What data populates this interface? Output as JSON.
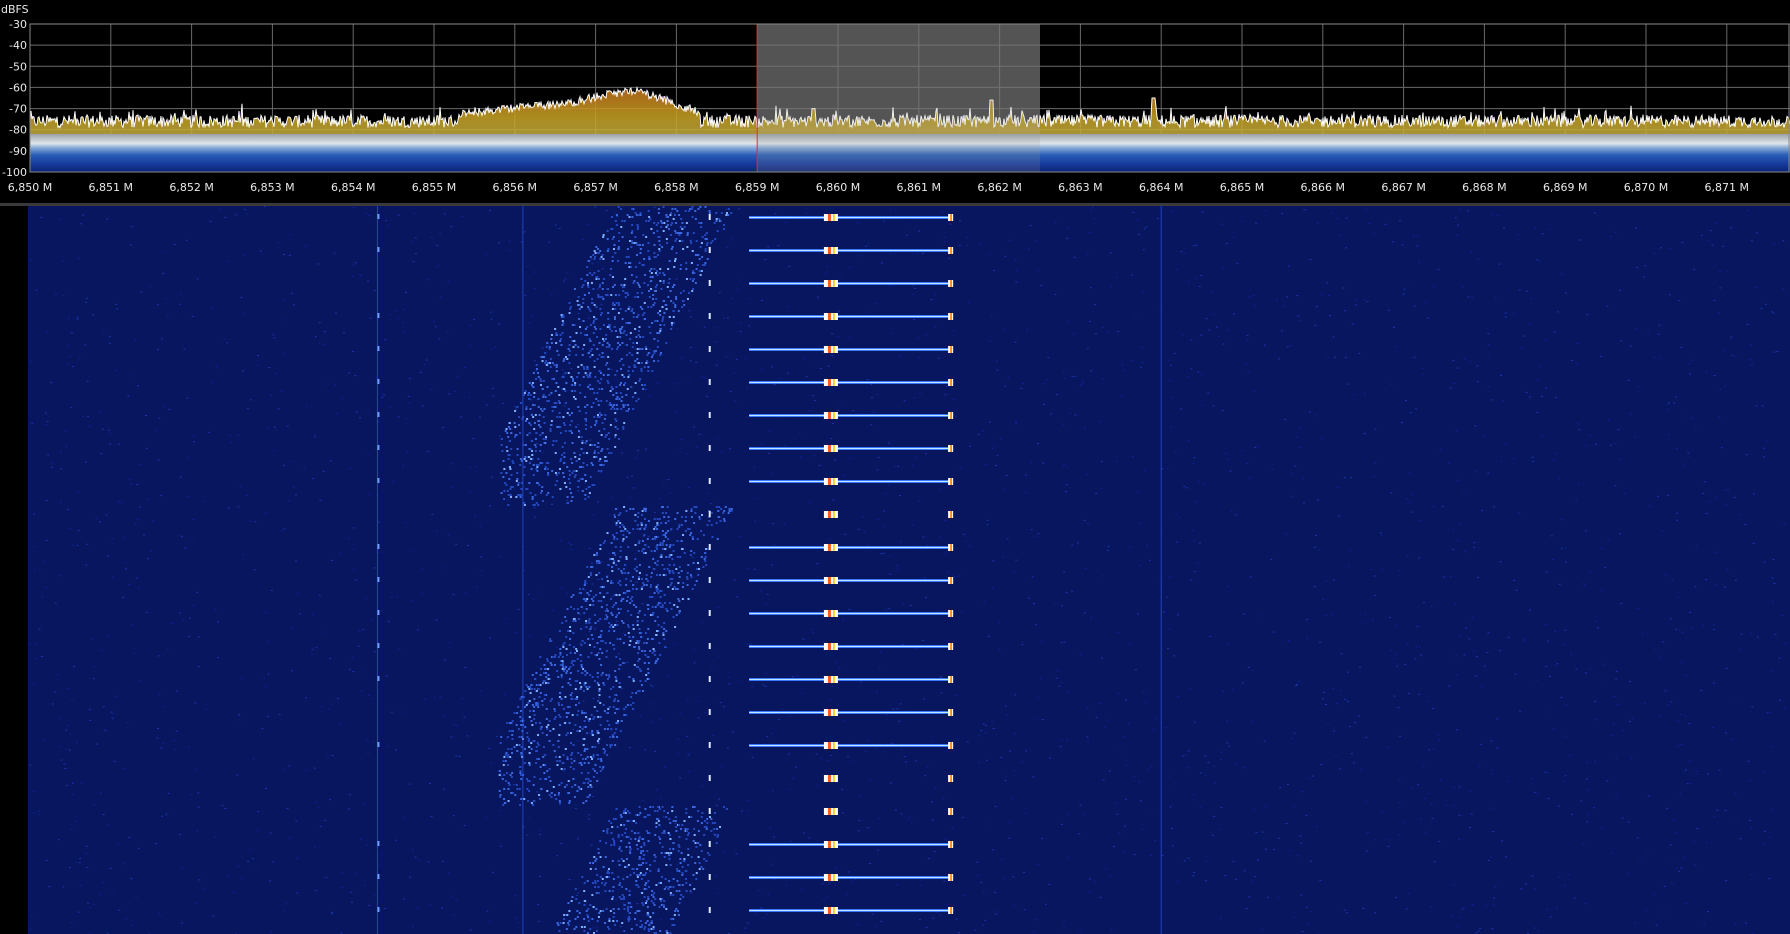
{
  "spectrum": {
    "unit_label": "dBFS",
    "db_ticks": [
      "-30",
      "-40",
      "-50",
      "-60",
      "-70",
      "-80",
      "-90",
      "-100"
    ],
    "db_range": [
      -100,
      -30
    ],
    "freq_ticks": [
      "6,850 M",
      "6,851 M",
      "6,852 M",
      "6,853 M",
      "6,854 M",
      "6,855 M",
      "6,856 M",
      "6,857 M",
      "6,858 M",
      "6,859 M",
      "6,860 M",
      "6,861 M",
      "6,862 M",
      "6,863 M",
      "6,864 M",
      "6,865 M",
      "6,866 M",
      "6,867 M",
      "6,868 M",
      "6,869 M",
      "6,870 M",
      "6,871 M"
    ],
    "freq_range_mhz": [
      6.85,
      6.8716
    ],
    "noise_floor_db": -76,
    "filter": {
      "start_mhz": 6.859,
      "end_mhz": 6.8625
    },
    "signal_hump": {
      "start_mhz": 6.8553,
      "end_mhz": 6.8583,
      "peak_mhz": 6.8575,
      "peak_db": -62
    },
    "spikes": [
      {
        "freq_mhz": 6.8619,
        "db": -66
      },
      {
        "freq_mhz": 6.8639,
        "db": -65
      },
      {
        "freq_mhz": 6.8597,
        "db": -70
      }
    ],
    "colors": {
      "grid": "#6a6a6a",
      "trace": "#ffffff",
      "filter_edge": "#ff2020",
      "filter_fill": "#9a9a9a"
    }
  },
  "waterfall": {
    "background": "#081660",
    "burst_rows": 22,
    "steady_lines_mhz": [
      6.8543,
      6.8561,
      6.864
    ],
    "carrier_left_mhz": 6.8599,
    "carrier_right_mhz": 6.8614,
    "dashed_line_mhz": 6.8584
  }
}
